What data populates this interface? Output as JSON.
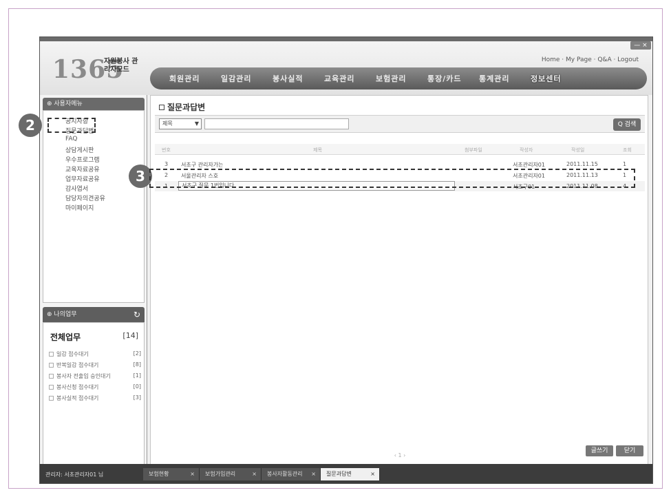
{
  "header": {
    "logo_number": "1365",
    "logo_sub": "자원봉사 관리자모드",
    "user_links": "Home · My Page · Q&A · Logout",
    "window_controls": "— ×",
    "nav": [
      {
        "label": "회원관리"
      },
      {
        "label": "일감관리"
      },
      {
        "label": "봉사실적"
      },
      {
        "label": "교육관리"
      },
      {
        "label": "보험관리"
      },
      {
        "label": "통장/카드"
      },
      {
        "label": "통계관리"
      },
      {
        "label": "정보센터"
      }
    ]
  },
  "sidebar": {
    "title": "⊕ 사용자메뉴",
    "items": [
      {
        "label": "공지사항"
      },
      {
        "label": "질문과답변"
      },
      {
        "label": "FAQ"
      },
      {
        "label": "상담게시판"
      },
      {
        "label": "우수프로그램"
      },
      {
        "label": "교육자료공유"
      },
      {
        "label": "업무자료공유"
      },
      {
        "label": "감사엽서"
      },
      {
        "label": "담당자의견공유"
      },
      {
        "label": "마이페이지"
      }
    ],
    "my_work": {
      "title": "⊕ 나의업무",
      "total_label": "전체업무",
      "total_count": "[14]",
      "rows": [
        {
          "label": "일감 접수대기",
          "count": "[2]"
        },
        {
          "label": "반복일감 접수대기",
          "count": "[8]"
        },
        {
          "label": "봉사자 전출입 승인대기",
          "count": "[1]"
        },
        {
          "label": "봉사신청 접수대기",
          "count": "[0]"
        },
        {
          "label": "봉사실적 접수대기",
          "count": "[3]"
        }
      ]
    }
  },
  "main": {
    "title": "질문과답변",
    "search": {
      "select_value": "제목",
      "input_value": "",
      "button_label": "Q 검색"
    },
    "table": {
      "headers": [
        "번호",
        "제목",
        "첨부파일",
        "작성자",
        "작성일",
        "조회"
      ],
      "rows": [
        {
          "no": "3",
          "title": "서초구 관리자가는",
          "author": "서초관리자01",
          "date": "2011.11.15",
          "views": "1"
        },
        {
          "no": "2",
          "title": "서울관리자 스호",
          "author": "서초관리자01",
          "date": "2011.11.13",
          "views": "1"
        },
        {
          "no": "1",
          "title": "서초구 질문 1번입니다.",
          "author": "서초구01",
          "date": "2011.11.08",
          "views": "4"
        }
      ]
    },
    "pagination": "‹ 1 ›",
    "write_label": "글쓰기",
    "close_label": "닫기"
  },
  "taskbar": {
    "admin_info": "관리자: 서초관리자01 님",
    "tabs": [
      {
        "label": "보험현황"
      },
      {
        "label": "보험가입관리"
      },
      {
        "label": "봉사자활동관리"
      },
      {
        "label": "질문과답변"
      }
    ]
  },
  "annotations": {
    "callout_2": "2",
    "callout_3": "3"
  }
}
